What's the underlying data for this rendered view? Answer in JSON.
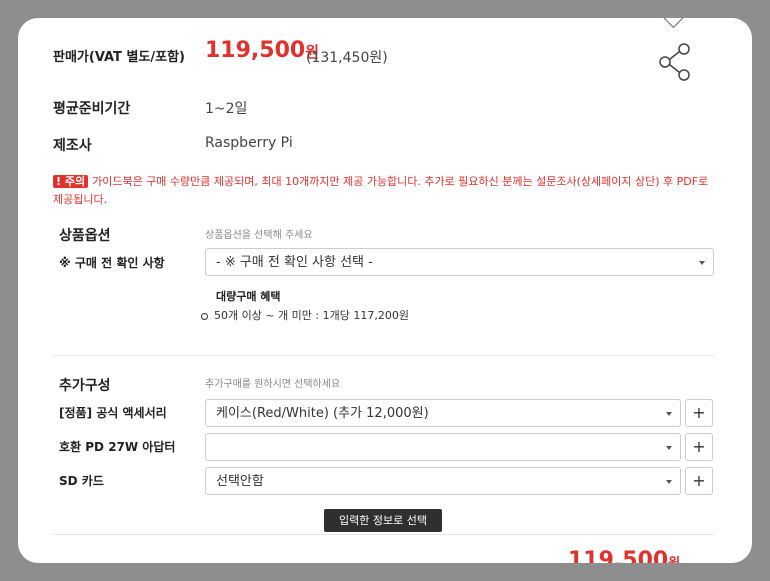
{
  "product": {
    "price_label": "판매가(VAT 별도/포함)",
    "price_main": "119,500",
    "price_unit": "원",
    "price_vat": "(131,450원)",
    "prep_label": "평균준비기간",
    "prep_value": "1~2일",
    "maker_label": "제조사",
    "maker_value": "Raspberry Pi"
  },
  "notice": {
    "tag": "! 주의",
    "text": "가이드북은 구매 수량만큼 제공되며, 최대 10개까지만 제공 가능합니다. 추가로 필요하신 분께는 설문조사(상세페이지 상단) 후 PDF로 제공됩니다."
  },
  "options": {
    "title": "상품옵션",
    "hint": "상품옵션을 선택해 주세요",
    "row_label": "※ 구매 전 확인 사항",
    "select_value": "- ※ 구매 전 확인 사항 선택 -",
    "bulk_title": "대량구매 혜택",
    "bulk_item": "50개 이상 ~ 개 미만 : 1개당 117,200원"
  },
  "extras": {
    "title": "추가구성",
    "hint": "추가구매를 원하시면 선택하세요",
    "rows": [
      {
        "label": "[정품] 공식 액세서리",
        "value": "케이스(Red/White) (추가 12,000원)"
      },
      {
        "label": "호환 PD 27W 아답터",
        "value": ""
      },
      {
        "label": "SD 카드",
        "value": "선택안함"
      }
    ],
    "plus_symbol": "+",
    "apply_button": "입력한 정보로 선택"
  },
  "footer": {
    "total_partial": "119,500",
    "total_unit": "원"
  },
  "colors": {
    "accent_red": "#e0322d",
    "button_dark": "#2f2f2f"
  },
  "icons": [
    "chevron-down-icon",
    "share-icon",
    "dropdown-arrow-icon",
    "plus-icon"
  ]
}
